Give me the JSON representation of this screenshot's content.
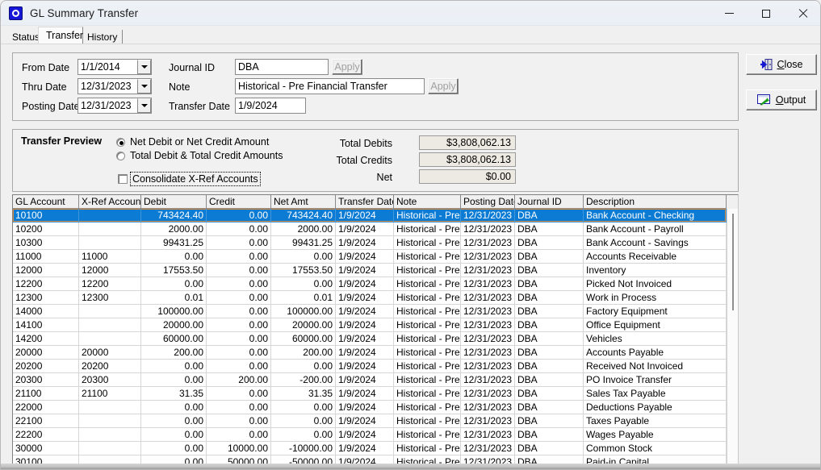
{
  "window": {
    "title": "GL Summary Transfer",
    "icon": "app-icon",
    "minimize_label": "─",
    "maximize_label": "□",
    "close_label": "✕"
  },
  "tabs": [
    {
      "label": "Status",
      "active": false
    },
    {
      "label": "Transfer",
      "active": true
    },
    {
      "label": "History",
      "active": false
    }
  ],
  "filters": {
    "from_date_label": "From Date",
    "from_date_value": "1/1/2014",
    "thru_date_label": "Thru Date",
    "thru_date_value": "12/31/2023",
    "posting_date_label": "Posting Date",
    "posting_date_value": "12/31/2023",
    "journal_id_label": "Journal ID",
    "journal_id_value": "DBA",
    "journal_apply_label": "Apply",
    "note_label": "Note",
    "note_value": "Historical - Pre Financial Transfer",
    "note_apply_label": "Apply",
    "transfer_date_label": "Transfer Date",
    "transfer_date_value": "1/9/2024"
  },
  "sidebuttons": {
    "close_label": "Close",
    "close_accel": "C",
    "output_label": "Output",
    "output_accel": "O"
  },
  "preview": {
    "title": "Transfer Preview",
    "radio_net_label": "Net Debit or Net Credit Amount",
    "radio_net_selected": true,
    "radio_total_label": "Total Debit & Total Credit Amounts",
    "radio_total_selected": false,
    "checkbox_label": "Consolidate X-Ref Accounts",
    "checkbox_checked": false,
    "total_debits_label": "Total Debits",
    "total_debits_value": "$3,808,062.13",
    "total_credits_label": "Total Credits",
    "total_credits_value": "$3,808,062.13",
    "net_label": "Net",
    "net_value": "$0.00"
  },
  "grid": {
    "columns": [
      {
        "key": "gl_account",
        "label": "GL Account",
        "width": 82,
        "align": "left"
      },
      {
        "key": "xref_account",
        "label": "X-Ref Account",
        "width": 77,
        "align": "left"
      },
      {
        "key": "debit",
        "label": "Debit",
        "width": 81,
        "align": "right"
      },
      {
        "key": "credit",
        "label": "Credit",
        "width": 80,
        "align": "right"
      },
      {
        "key": "net_amt",
        "label": "Net Amt",
        "width": 80,
        "align": "right"
      },
      {
        "key": "transfer_date",
        "label": "Transfer Date",
        "width": 72,
        "align": "left"
      },
      {
        "key": "note",
        "label": "Note",
        "width": 83,
        "align": "left"
      },
      {
        "key": "posting_date",
        "label": "Posting Date",
        "width": 67,
        "align": "left"
      },
      {
        "key": "journal_id",
        "label": "Journal ID",
        "width": 85,
        "align": "left"
      },
      {
        "key": "description",
        "label": "Description",
        "width": 177,
        "align": "left"
      }
    ],
    "selected_row_index": 0,
    "rows": [
      {
        "gl_account": "10100",
        "xref_account": "",
        "debit": "743424.40",
        "credit": "0.00",
        "net_amt": "743424.40",
        "transfer_date": "1/9/2024",
        "note": "Historical - Pre Fi",
        "posting_date": "12/31/2023",
        "journal_id": "DBA",
        "description": "Bank Account - Checking"
      },
      {
        "gl_account": "10200",
        "xref_account": "",
        "debit": "2000.00",
        "credit": "0.00",
        "net_amt": "2000.00",
        "transfer_date": "1/9/2024",
        "note": "Historical - Pre Fi",
        "posting_date": "12/31/2023",
        "journal_id": "DBA",
        "description": "Bank Account - Payroll"
      },
      {
        "gl_account": "10300",
        "xref_account": "",
        "debit": "99431.25",
        "credit": "0.00",
        "net_amt": "99431.25",
        "transfer_date": "1/9/2024",
        "note": "Historical - Pre Fi",
        "posting_date": "12/31/2023",
        "journal_id": "DBA",
        "description": "Bank Account - Savings"
      },
      {
        "gl_account": "11000",
        "xref_account": "11000",
        "debit": "0.00",
        "credit": "0.00",
        "net_amt": "0.00",
        "transfer_date": "1/9/2024",
        "note": "Historical - Pre Fi",
        "posting_date": "12/31/2023",
        "journal_id": "DBA",
        "description": "Accounts Receivable"
      },
      {
        "gl_account": "12000",
        "xref_account": "12000",
        "debit": "17553.50",
        "credit": "0.00",
        "net_amt": "17553.50",
        "transfer_date": "1/9/2024",
        "note": "Historical - Pre Fi",
        "posting_date": "12/31/2023",
        "journal_id": "DBA",
        "description": "Inventory"
      },
      {
        "gl_account": "12200",
        "xref_account": "12200",
        "debit": "0.00",
        "credit": "0.00",
        "net_amt": "0.00",
        "transfer_date": "1/9/2024",
        "note": "Historical - Pre Fi",
        "posting_date": "12/31/2023",
        "journal_id": "DBA",
        "description": "Picked Not Invoiced"
      },
      {
        "gl_account": "12300",
        "xref_account": "12300",
        "debit": "0.01",
        "credit": "0.00",
        "net_amt": "0.01",
        "transfer_date": "1/9/2024",
        "note": "Historical - Pre Fi",
        "posting_date": "12/31/2023",
        "journal_id": "DBA",
        "description": "Work in Process"
      },
      {
        "gl_account": "14000",
        "xref_account": "",
        "debit": "100000.00",
        "credit": "0.00",
        "net_amt": "100000.00",
        "transfer_date": "1/9/2024",
        "note": "Historical - Pre Fi",
        "posting_date": "12/31/2023",
        "journal_id": "DBA",
        "description": "Factory Equipment"
      },
      {
        "gl_account": "14100",
        "xref_account": "",
        "debit": "20000.00",
        "credit": "0.00",
        "net_amt": "20000.00",
        "transfer_date": "1/9/2024",
        "note": "Historical - Pre Fi",
        "posting_date": "12/31/2023",
        "journal_id": "DBA",
        "description": "Office Equipment"
      },
      {
        "gl_account": "14200",
        "xref_account": "",
        "debit": "60000.00",
        "credit": "0.00",
        "net_amt": "60000.00",
        "transfer_date": "1/9/2024",
        "note": "Historical - Pre Fi",
        "posting_date": "12/31/2023",
        "journal_id": "DBA",
        "description": "Vehicles"
      },
      {
        "gl_account": "20000",
        "xref_account": "20000",
        "debit": "200.00",
        "credit": "0.00",
        "net_amt": "200.00",
        "transfer_date": "1/9/2024",
        "note": "Historical - Pre Fi",
        "posting_date": "12/31/2023",
        "journal_id": "DBA",
        "description": "Accounts Payable"
      },
      {
        "gl_account": "20200",
        "xref_account": "20200",
        "debit": "0.00",
        "credit": "0.00",
        "net_amt": "0.00",
        "transfer_date": "1/9/2024",
        "note": "Historical - Pre Fi",
        "posting_date": "12/31/2023",
        "journal_id": "DBA",
        "description": "Received Not Invoiced"
      },
      {
        "gl_account": "20300",
        "xref_account": "20300",
        "debit": "0.00",
        "credit": "200.00",
        "net_amt": "-200.00",
        "transfer_date": "1/9/2024",
        "note": "Historical - Pre Fi",
        "posting_date": "12/31/2023",
        "journal_id": "DBA",
        "description": "PO Invoice Transfer"
      },
      {
        "gl_account": "21100",
        "xref_account": "21100",
        "debit": "31.35",
        "credit": "0.00",
        "net_amt": "31.35",
        "transfer_date": "1/9/2024",
        "note": "Historical - Pre Fi",
        "posting_date": "12/31/2023",
        "journal_id": "DBA",
        "description": "Sales Tax Payable"
      },
      {
        "gl_account": "22000",
        "xref_account": "",
        "debit": "0.00",
        "credit": "0.00",
        "net_amt": "0.00",
        "transfer_date": "1/9/2024",
        "note": "Historical - Pre Fi",
        "posting_date": "12/31/2023",
        "journal_id": "DBA",
        "description": "Deductions Payable"
      },
      {
        "gl_account": "22100",
        "xref_account": "",
        "debit": "0.00",
        "credit": "0.00",
        "net_amt": "0.00",
        "transfer_date": "1/9/2024",
        "note": "Historical - Pre Fi",
        "posting_date": "12/31/2023",
        "journal_id": "DBA",
        "description": "Taxes Payable"
      },
      {
        "gl_account": "22200",
        "xref_account": "",
        "debit": "0.00",
        "credit": "0.00",
        "net_amt": "0.00",
        "transfer_date": "1/9/2024",
        "note": "Historical - Pre Fi",
        "posting_date": "12/31/2023",
        "journal_id": "DBA",
        "description": "Wages Payable"
      },
      {
        "gl_account": "30000",
        "xref_account": "",
        "debit": "0.00",
        "credit": "10000.00",
        "net_amt": "-10000.00",
        "transfer_date": "1/9/2024",
        "note": "Historical - Pre Fi",
        "posting_date": "12/31/2023",
        "journal_id": "DBA",
        "description": "Common Stock"
      },
      {
        "gl_account": "30100",
        "xref_account": "",
        "debit": "0.00",
        "credit": "50000.00",
        "net_amt": "-50000.00",
        "transfer_date": "1/9/2024",
        "note": "Historical - Pre Fi",
        "posting_date": "12/31/2023",
        "journal_id": "DBA",
        "description": "Paid-in Capital"
      }
    ]
  },
  "colors": {
    "selection": "#0b7bd4",
    "selection_border": "#d98a3a",
    "window_bg": "#f0f0f0",
    "titlebar_bg": "#eef2f7",
    "readonly_field": "#eceae2"
  }
}
